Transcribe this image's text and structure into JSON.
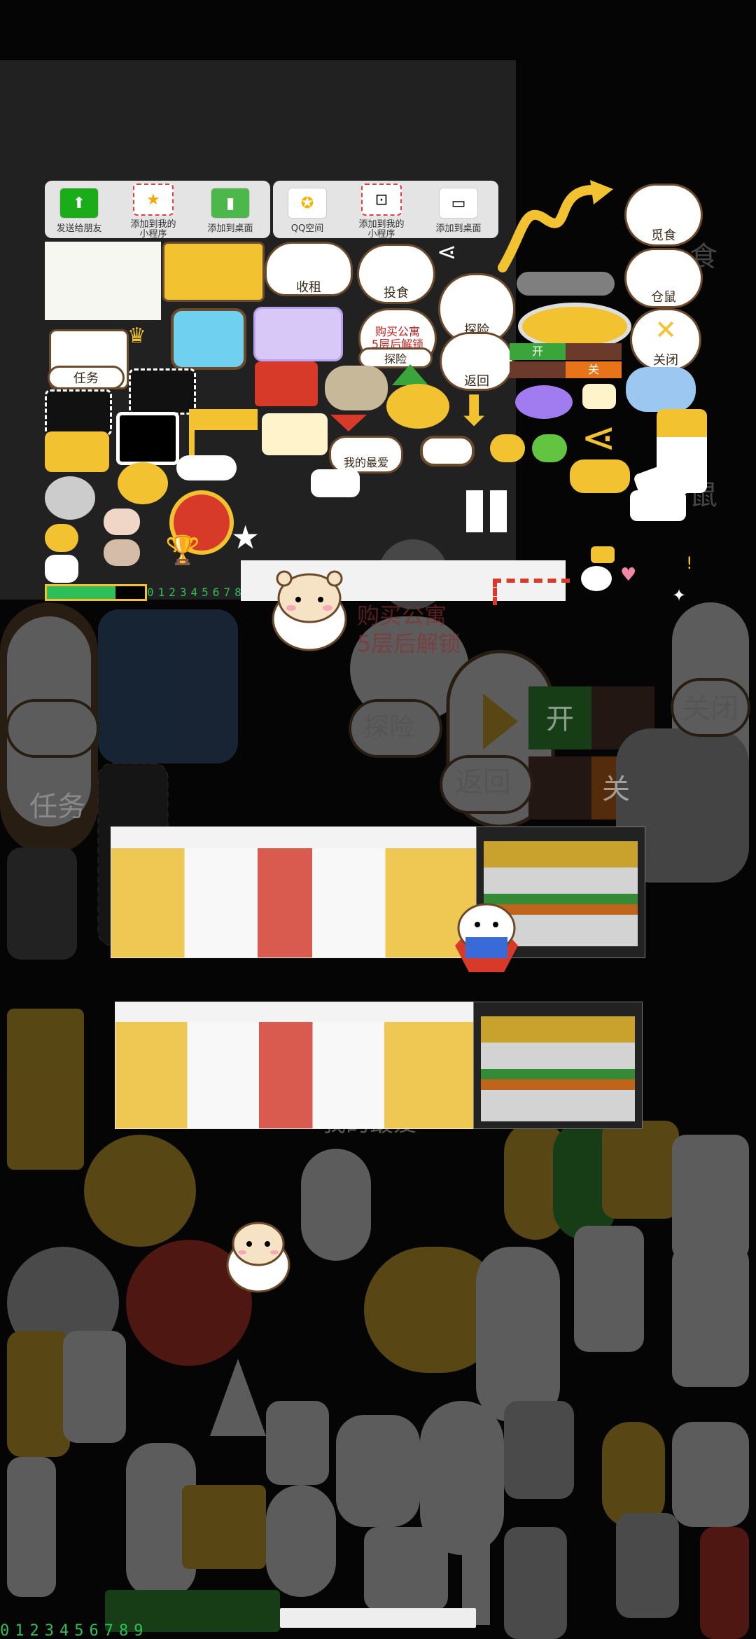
{
  "share_panel": {
    "left_items": [
      {
        "label": "发送给朋友",
        "icon": "share-friend-icon"
      },
      {
        "label": "添加到我的\n小程序",
        "icon": "star-icon"
      },
      {
        "label": "添加到桌面",
        "icon": "desktop-icon"
      }
    ],
    "right_items": [
      {
        "label": "QQ空间",
        "icon": "qzone-icon"
      },
      {
        "label": "添加到我的\n小程序",
        "icon": "add-box-icon"
      },
      {
        "label": "添加到桌面",
        "icon": "monitor-icon"
      }
    ]
  },
  "buttons": {
    "collect_rent": "收租",
    "feed": "投食",
    "explore": "探险",
    "explore_2": "探险",
    "back": "返回",
    "forage": "觅食",
    "warehouse": "仓鼠",
    "close": "关闭",
    "task": "任务",
    "my_favorite": "我的最爱",
    "on": "开",
    "off": "关",
    "apartment_unlock": "购买公寓\n5层后解锁"
  },
  "background_labels": {
    "task": "任务",
    "explore": "探险",
    "back": "返回",
    "close": "关闭",
    "on": "开",
    "off": "关",
    "unlock": "购买公寓\n5层后解锁",
    "favorite": "我的最爱",
    "food": "食",
    "rat": "鼠"
  },
  "digits": "0123456789",
  "colors": {
    "accent_yellow": "#f2c230",
    "brown": "#6b4a2b",
    "green": "#3aa53a",
    "orange": "#e8741a",
    "red": "#d83a2a"
  }
}
